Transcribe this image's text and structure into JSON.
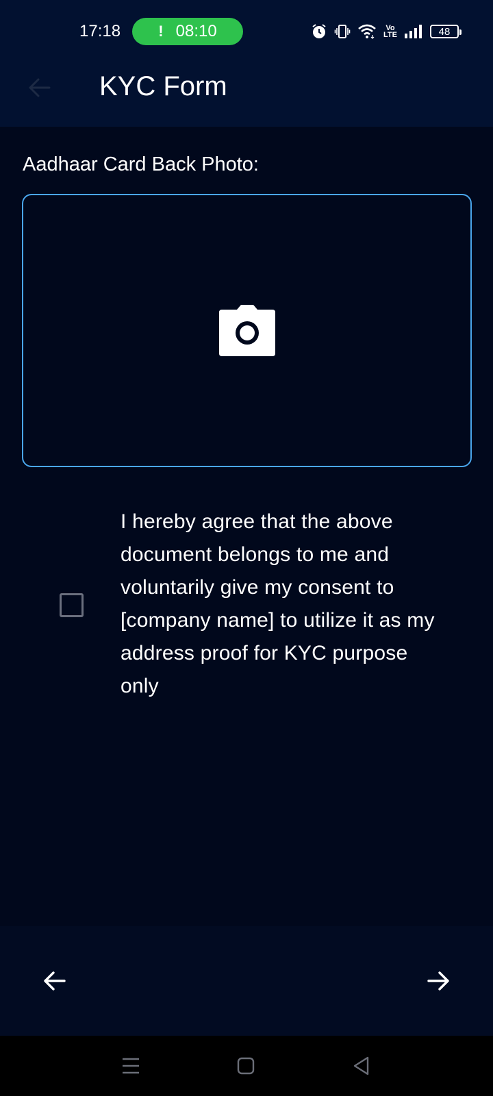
{
  "status_bar": {
    "time": "17:18",
    "call_timer": "08:10",
    "call_indicator": "!",
    "volte_top": "Vo",
    "volte_bottom": "LTE",
    "battery": "48",
    "icons": [
      "alarm-icon",
      "vibrate-icon",
      "wifi-icon",
      "volte-icon",
      "signal-icon",
      "battery-icon"
    ]
  },
  "app_bar": {
    "title": "KYC Form",
    "back_icon": "arrow-left-icon"
  },
  "form": {
    "section_label": "Aadhaar Card Back Photo:",
    "photo_icon": "camera-icon",
    "consent_text": "I hereby agree that the above document belongs to me and voluntarily give my consent to [company name] to utilize it as my address proof for KYC purpose only",
    "consent_checked": false
  },
  "bottom_nav": {
    "prev_icon": "arrow-left-icon",
    "next_icon": "arrow-right-icon"
  },
  "system_nav": {
    "icons": [
      "menu-icon",
      "home-icon",
      "back-icon"
    ]
  },
  "colors": {
    "background": "#01081c",
    "app_bar": "#021130",
    "accent_border": "#4aa6ec",
    "call_pill": "#2ec24d"
  }
}
